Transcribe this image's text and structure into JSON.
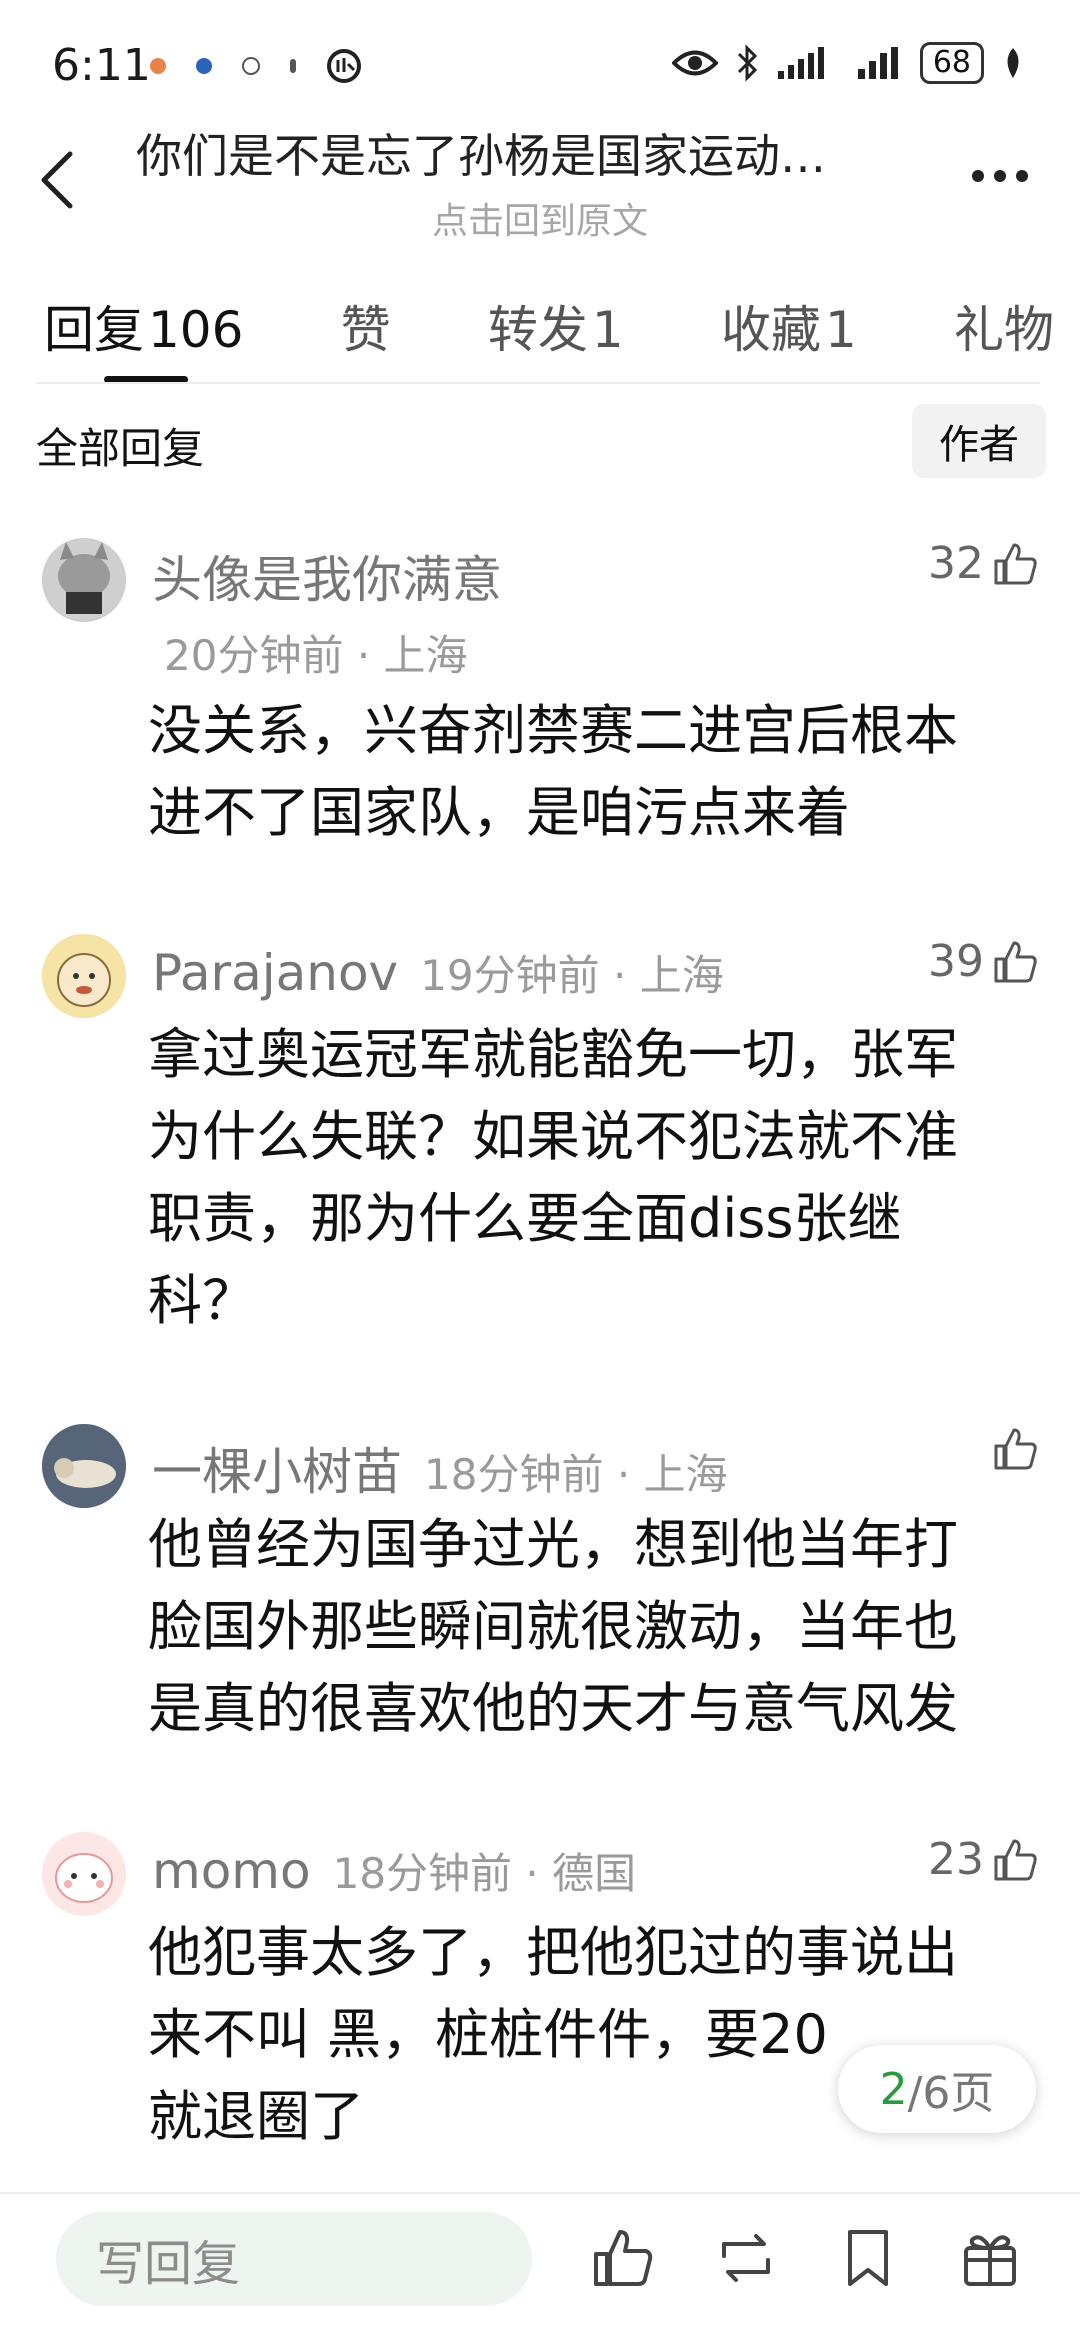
{
  "status_bar": {
    "time": "6:11",
    "battery": "68",
    "icons": [
      "app-notification-icon",
      "eye-icon",
      "bluetooth-icon",
      "signal-icon",
      "signal-icon",
      "battery-icon",
      "leaf-icon"
    ]
  },
  "header": {
    "title": "你们是不是忘了孙杨是国家运动…",
    "subtitle": "点击回到原文"
  },
  "tabs": [
    {
      "label": "回复",
      "count": "106"
    },
    {
      "label": "赞",
      "count": ""
    },
    {
      "label": "转发",
      "count": "1"
    },
    {
      "label": "收藏",
      "count": "1"
    },
    {
      "label": "礼物",
      "count": ""
    }
  ],
  "filter": {
    "all_label": "全部回复",
    "author_label": "作者"
  },
  "comments": [
    {
      "name": "头像是我你满意",
      "time": "20分钟前",
      "location": "上海",
      "likes": "32",
      "text": [
        "没关系，兴奋剂禁赛二进宫后根本",
        "进不了国家队，是咱污点来着"
      ]
    },
    {
      "name": "Parajanov",
      "time": "19分钟前",
      "location": "上海",
      "likes": "39",
      "text": [
        "拿过奥运冠军就能豁免一切，张军",
        "为什么失联？如果说不犯法就不准",
        "职责，那为什么要全面diss张继",
        "科？"
      ]
    },
    {
      "name": "一棵小树苗",
      "time": "18分钟前",
      "location": "上海",
      "likes": "",
      "text": [
        "他曾经为国争过光，想到他当年打",
        "脸国外那些瞬间就很激动，当年也",
        "是真的很喜欢他的天才与意气风发"
      ]
    },
    {
      "name": "momo",
      "time": "18分钟前",
      "location": "德国",
      "likes": "23",
      "text": [
        "他犯事太多了，把他犯过的事说出",
        "来不叫 黑，桩桩件件，要20",
        "就退圈了"
      ]
    }
  ],
  "separator": "·",
  "page_indicator": {
    "current": "2",
    "total": "/6页"
  },
  "bottom_bar": {
    "reply_placeholder": "写回复"
  }
}
